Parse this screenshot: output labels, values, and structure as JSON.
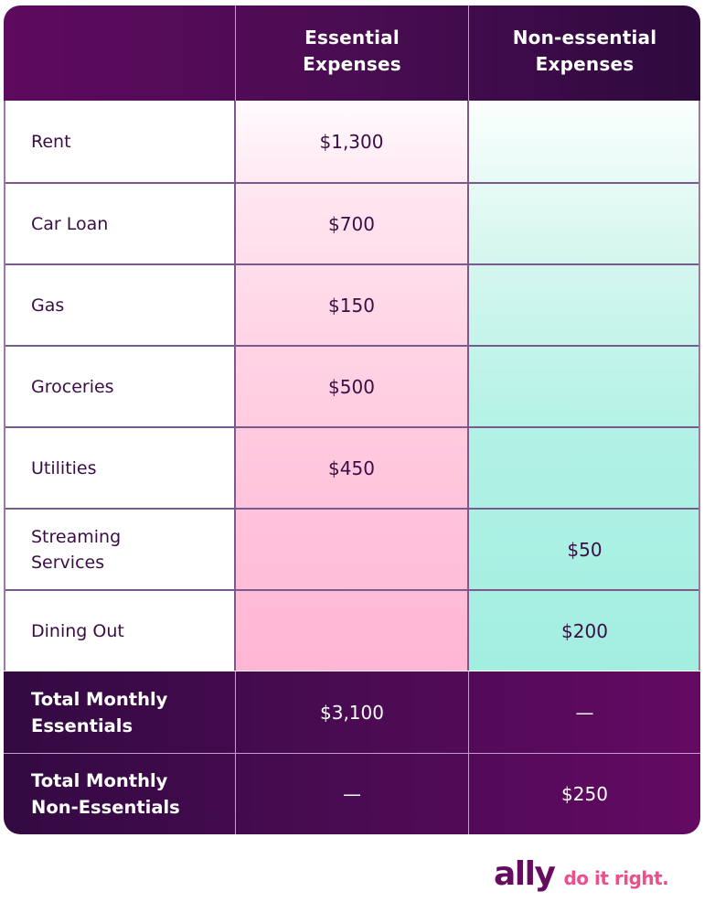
{
  "table": {
    "columns": [
      "",
      "Essential Expenses",
      "Non-essential Expenses"
    ],
    "header": {
      "col1_line1": "Essential",
      "col1_line2": "Expenses",
      "col2_line1": "Non-essential",
      "col2_line2": "Expenses"
    },
    "rows": [
      {
        "label": "Rent",
        "essential": "$1,300",
        "non_essential": ""
      },
      {
        "label": "Car Loan",
        "essential": "$700",
        "non_essential": ""
      },
      {
        "label": "Gas",
        "essential": "$150",
        "non_essential": ""
      },
      {
        "label": "Groceries",
        "essential": "$500",
        "non_essential": ""
      },
      {
        "label": "Utilities",
        "essential": "$450",
        "non_essential": ""
      },
      {
        "label_line1": "Streaming",
        "label_line2": "Services",
        "essential": "",
        "non_essential": "$50"
      },
      {
        "label": "Dining Out",
        "essential": "",
        "non_essential": "$200"
      }
    ],
    "totals": [
      {
        "label_line1": "Total Monthly",
        "label_line2": "Essentials",
        "essential": "$3,100",
        "non_essential": "—"
      },
      {
        "label_line1": "Total Monthly",
        "label_line2": "Non-Essentials",
        "essential": "—",
        "non_essential": "$250"
      }
    ]
  },
  "brand": {
    "logo": "ally",
    "tagline": "do it right."
  },
  "colors": {
    "header_purple": "#5e0a5e",
    "dark_purple": "#330a42",
    "essential_pink": "#ffc9de",
    "non_essential_teal": "#b1f1e5",
    "brand_purple": "#650c5f",
    "brand_pink": "#ec4f8b"
  }
}
